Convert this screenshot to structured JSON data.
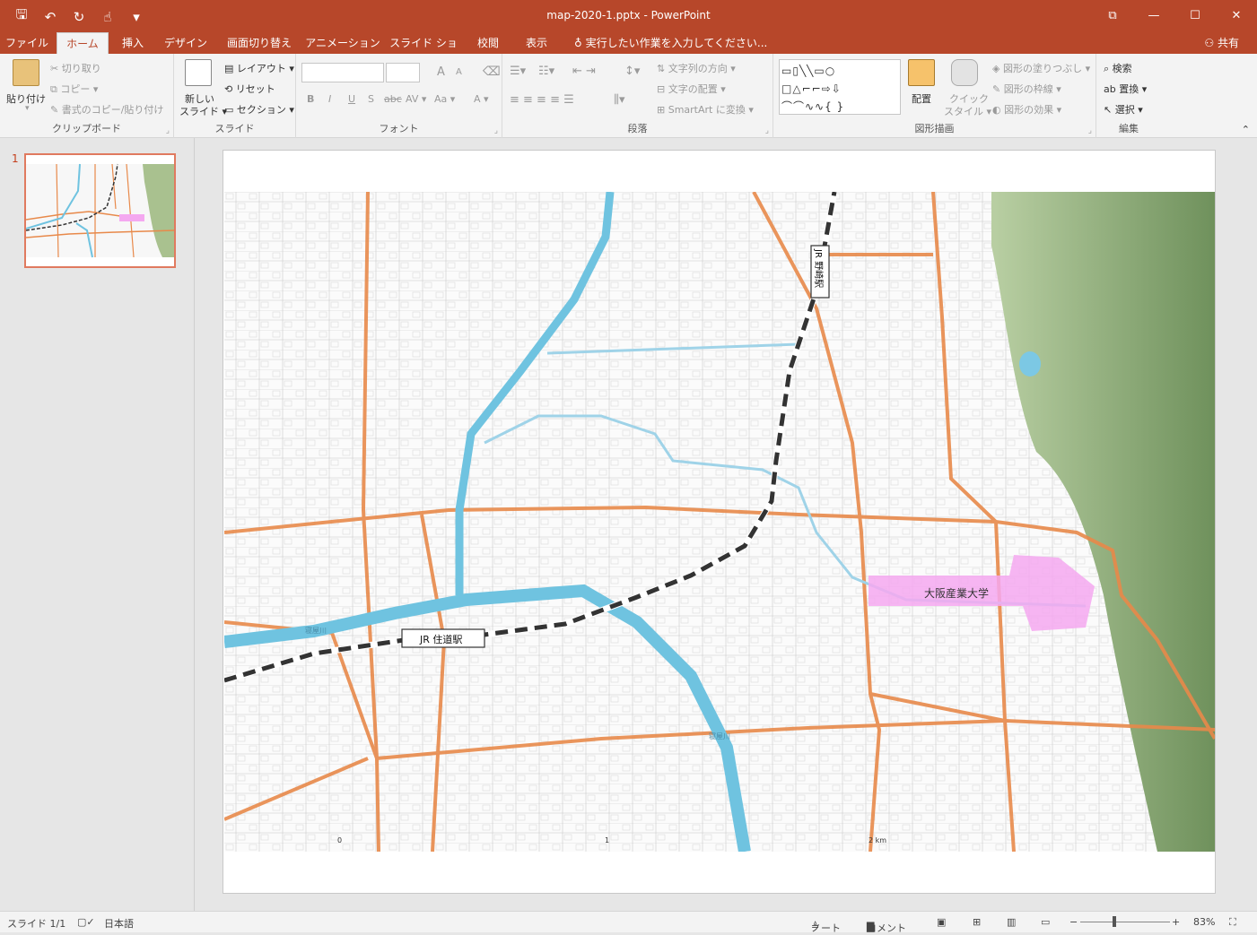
{
  "window": {
    "title": "map-2020-1.pptx - PowerPoint",
    "qat": {
      "save": "🖫",
      "undo": "↶",
      "redo": "↻",
      "touch": "☝",
      "more": "▾"
    },
    "buttons": {
      "restore": "⧉",
      "minimize": "—",
      "maximize": "☐",
      "close": "✕"
    }
  },
  "tabs": [
    "ファイル",
    "ホーム",
    "挿入",
    "デザイン",
    "画面切り替え",
    "アニメーション",
    "スライド ショー",
    "校閲",
    "表示"
  ],
  "active_tab": "ホーム",
  "tell_me": "実行したい作業を入力してください...",
  "share": "共有",
  "ribbon": {
    "clipboard": {
      "label": "クリップボード",
      "paste": "貼り付け",
      "cut": "切り取り",
      "copy": "コピー",
      "format_painter": "書式のコピー/貼り付け"
    },
    "slides": {
      "label": "スライド",
      "new_slide_1": "新しい",
      "new_slide_2": "スライド",
      "layout": "レイアウト",
      "reset": "リセット",
      "section": "セクション"
    },
    "font": {
      "label": "フォント",
      "bold": "B",
      "italic": "I",
      "underline": "U",
      "shadow": "S",
      "strike": "abc",
      "spacing": "AV",
      "case": "Aa",
      "color": "A",
      "grow": "A",
      "shrink": "A"
    },
    "paragraph": {
      "label": "段落",
      "text_direction": "文字列の方向",
      "align_text": "文字の配置",
      "smartart": "SmartArt に変換"
    },
    "drawing": {
      "label": "図形描画",
      "arrange": "配置",
      "quick_styles_1": "クイック",
      "quick_styles_2": "スタイル",
      "shape_fill": "図形の塗りつぶし",
      "shape_outline": "図形の枠線",
      "shape_effects": "図形の効果",
      "shapes_gallery": "▭▯╲╲▭○\n□△⌐⌐⇨⇩\n⌒⌒∿∿{ }"
    },
    "editing": {
      "label": "編集",
      "find": "検索",
      "replace": "置換",
      "select": "選択"
    }
  },
  "slide_pane": {
    "number": "1"
  },
  "map": {
    "jr_sumimichi": "JR 住道駅",
    "jr_nozaki": "JR 野崎駅",
    "university": "大阪産業大学",
    "river1": "寝屋川",
    "river2": "寝屋川",
    "scale0": "0",
    "scale1": "1",
    "scale2": "2 km"
  },
  "status": {
    "slide": "スライド 1/1",
    "language": "日本語",
    "notes": "ノート",
    "comments": "コメント",
    "zoom": "83%"
  },
  "colors": {
    "accent": "#b7472a",
    "road": "#e8894a",
    "river": "#6fc3e0",
    "university": "#f4a8f0",
    "forest": "#7ea36b"
  }
}
